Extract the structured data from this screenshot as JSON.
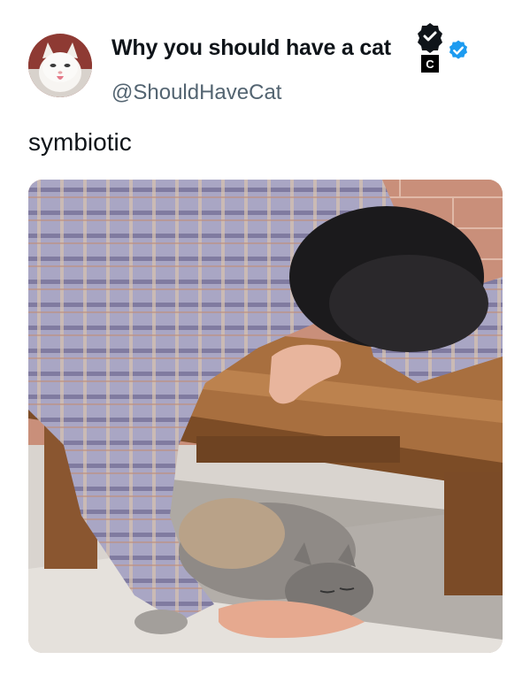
{
  "tweet": {
    "display_name": "Why you should have a cat",
    "handle": "@ShouldHaveCat",
    "text": "symbiotic"
  },
  "icons": {
    "verified": "verified-badge-icon",
    "affiliate": "affiliate-badge-icon",
    "affiliate_letter": "C"
  },
  "colors": {
    "verified_blue": "#1d9bf0",
    "handle_gray": "#536471",
    "text": "#0f1419"
  },
  "media": {
    "type": "photo"
  }
}
